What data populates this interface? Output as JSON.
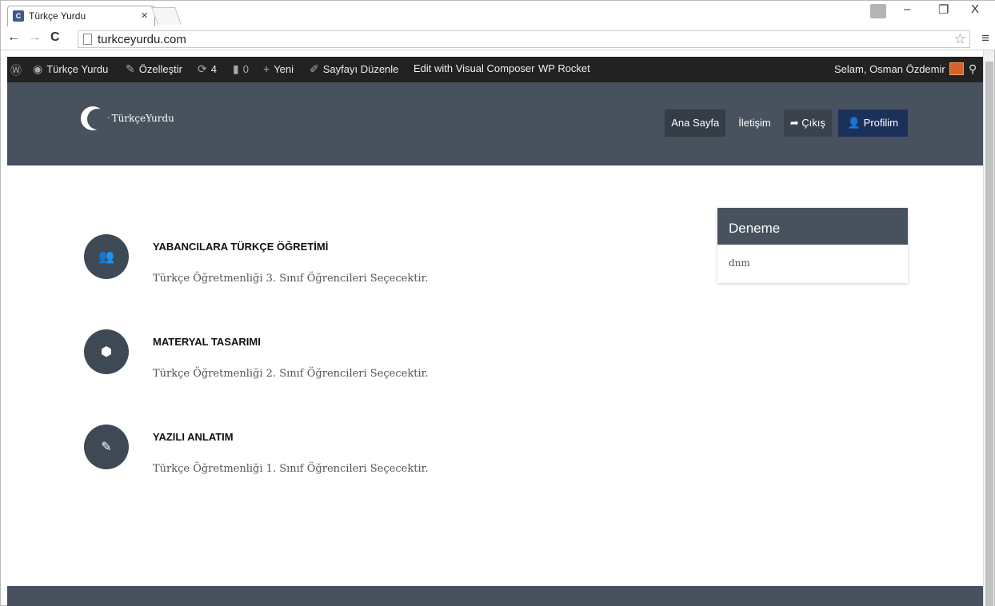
{
  "browser": {
    "tab_title": "Türkçe Yurdu",
    "tab_close": "×",
    "url": "turkceyurdu.com",
    "back": "←",
    "forward": "→",
    "reload": "C",
    "star": "☆",
    "menu": "≡",
    "minimize": "–",
    "restore": "❐",
    "close": "X"
  },
  "adminbar": {
    "wp_logo": "Ⓦ",
    "site": "Türkçe Yurdu",
    "customize": "Özelleştir",
    "updates": "4",
    "comments": "0",
    "new": "Yeni",
    "edit_page": "Sayfayı Düzenle",
    "visual_composer": "Edit with Visual Composer",
    "wp_rocket": "WP Rocket",
    "greeting": "Selam, Osman Özdemir",
    "search_icon": "search-icon"
  },
  "header": {
    "logo_text": "TürkçeYurdu",
    "nav": [
      "Ana Sayfa",
      "İletişim",
      "Çıkış",
      "Profilim"
    ]
  },
  "features": [
    {
      "icon": "users-icon",
      "title": "YABANCILARA TÜRKÇE ÖĞRETİMİ",
      "text": "Türkçe Öğretmenliği 3. Sınıf Öğrencileri Seçecektir."
    },
    {
      "icon": "cube-icon",
      "title": "MATERYAL TASARIMI",
      "text": "Türkçe Öğretmenliği 2. Sınıf Öğrencileri Seçecektir."
    },
    {
      "icon": "pencil-icon",
      "title": "YAZILI ANLATIM",
      "text": "Türkçe Öğretmenliği 1. Sınıf Öğrencileri Seçecektir."
    }
  ],
  "widget": {
    "title": "Deneme",
    "body": "dnm"
  },
  "colors": {
    "header_bg": "#48525e",
    "adminbar_bg": "#222222",
    "profile_btn": "#1b3159"
  }
}
